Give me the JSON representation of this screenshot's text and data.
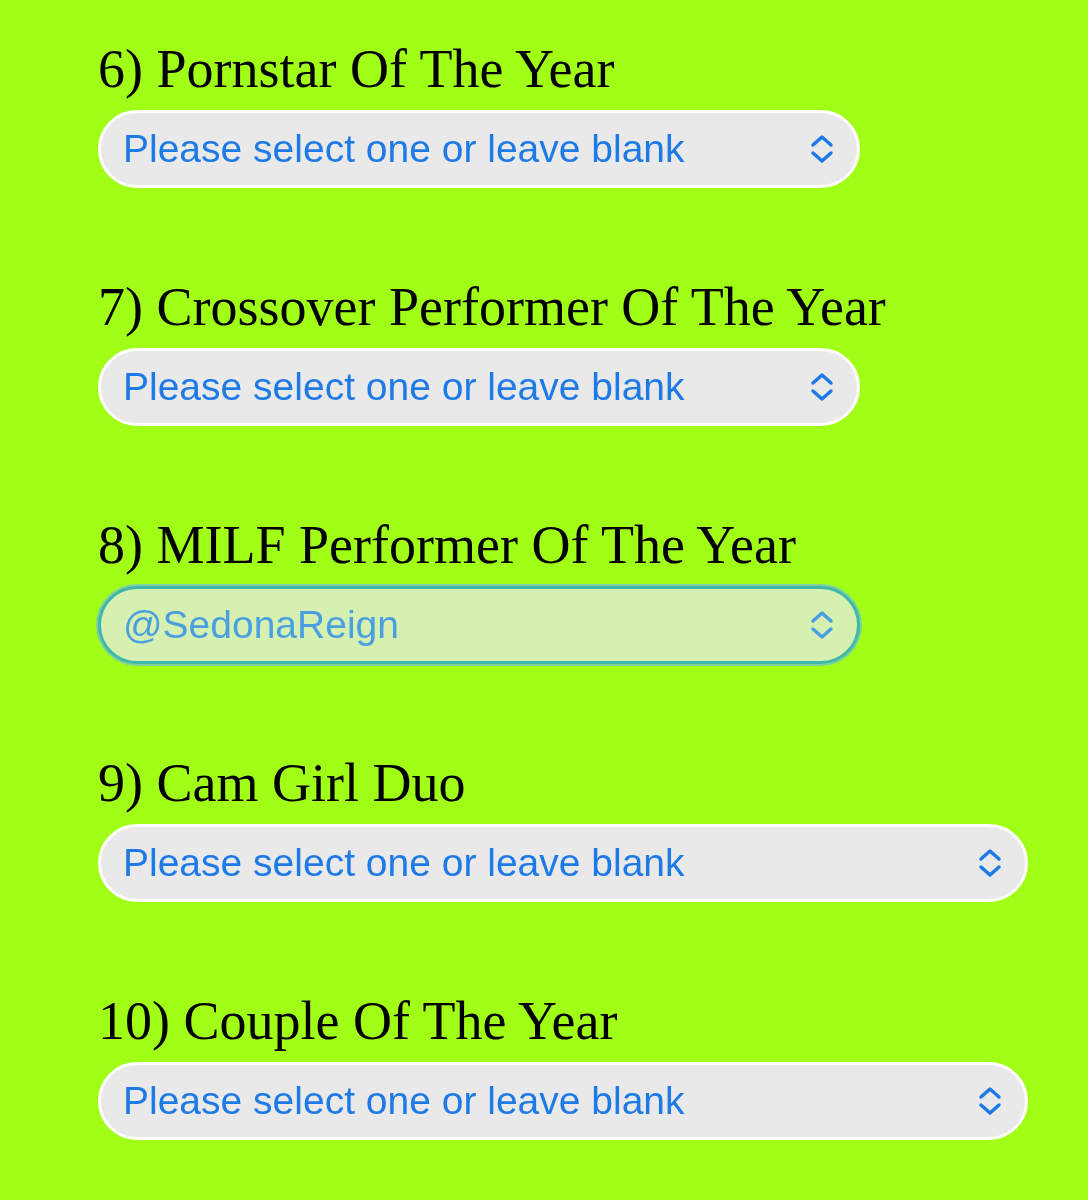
{
  "questions": [
    {
      "label": "6) Pornstar Of The Year",
      "select": {
        "placeholder": "Please select one or leave blank",
        "focused": false
      }
    },
    {
      "label": "7) Crossover Performer Of The Year",
      "select": {
        "placeholder": "Please select one or leave blank",
        "focused": false
      }
    },
    {
      "label": "8) MILF Performer Of The Year",
      "select": {
        "value": "@SedonaReign",
        "focused": true
      }
    },
    {
      "label": "9) Cam Girl Duo",
      "select": {
        "placeholder": "Please select one or leave blank",
        "focused": false
      }
    },
    {
      "label": "10) Couple Of The Year",
      "select": {
        "placeholder": "Please select one or leave blank",
        "focused": false
      }
    }
  ]
}
